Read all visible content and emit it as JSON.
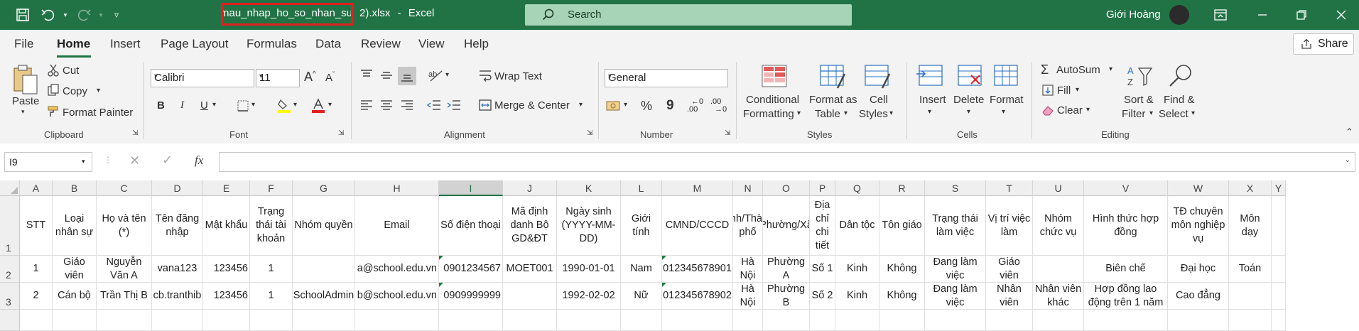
{
  "titlebar": {
    "doc_name": "mau_nhap_ho_so_nhan_su",
    "doc_suffix": "2).xlsx",
    "sep": "-",
    "app": "Excel",
    "search_label": "Search",
    "user_name": "Giới Hoàng",
    "accent": "#217346",
    "highlight": "#e02020"
  },
  "menu": {
    "tabs": [
      "File",
      "Home",
      "Insert",
      "Page Layout",
      "Formulas",
      "Data",
      "Review",
      "View",
      "Help"
    ],
    "active": "Home",
    "share": "Share"
  },
  "ribbon": {
    "paste": "Paste",
    "cut": "Cut",
    "copy": "Copy",
    "format_painter": "Format Painter",
    "clipboard": "Clipboard",
    "font_name": "Calibri",
    "font_size": "11",
    "bold": "B",
    "italic": "I",
    "underline": "U",
    "font": "Font",
    "wrap_text": "Wrap Text",
    "merge_center": "Merge & Center",
    "alignment": "Alignment",
    "number_format": "General",
    "percent": "%",
    "comma": "9",
    "inc_dec": ".00",
    "dec_dec": ".00",
    "number": "Number",
    "conditional_1": "Conditional",
    "conditional_2": "Formatting",
    "format_as_1": "Format as",
    "format_as_2": "Table",
    "cell_styles_1": "Cell",
    "cell_styles_2": "Styles",
    "styles": "Styles",
    "insert": "Insert",
    "delete": "Delete",
    "format": "Format",
    "cells": "Cells",
    "autosum": "AutoSum",
    "fill": "Fill",
    "clear": "Clear",
    "sort_1": "Sort &",
    "sort_2": "Filter",
    "find_1": "Find &",
    "find_2": "Select",
    "editing": "Editing"
  },
  "formula_bar": {
    "name_box": "I9",
    "fx": "fx",
    "value": ""
  },
  "sheet": {
    "columns": [
      "A",
      "B",
      "C",
      "D",
      "E",
      "F",
      "G",
      "H",
      "I",
      "J",
      "K",
      "L",
      "M",
      "N",
      "O",
      "P",
      "Q",
      "R",
      "S",
      "T",
      "U",
      "V",
      "W",
      "X",
      "Y"
    ],
    "selected_column": "I",
    "rows": [
      "1",
      "2",
      "3"
    ],
    "header_row": [
      "STT",
      "Loại nhân sự",
      "Họ và tên (*)",
      "Tên đăng nhập",
      "Mật khẩu",
      "Trạng thái tài khoản",
      "Nhóm quyền",
      "Email",
      "Số điện thoại",
      "Mã định danh Bộ GD&ĐT",
      "Ngày sinh (YYYY-MM-DD)",
      "Giới tính",
      "CMND/CCCD",
      "Tỉnh/Thành phố",
      "Phường/Xã",
      "Địa chỉ chi tiết",
      "Dân tộc",
      "Tôn giáo",
      "Trạng thái làm việc",
      "Vị trí việc làm",
      "Nhóm chức vụ",
      "Hình thức hợp đồng",
      "TĐ chuyên môn nghiệp vụ",
      "Môn dạy"
    ],
    "data_rows": [
      [
        "1",
        "Giáo viên",
        "Nguyễn Văn A",
        "vana123",
        "123456",
        "1",
        "",
        "a@school.edu.vn",
        "0901234567",
        "MOET001",
        "1990-01-01",
        "Nam",
        "012345678901",
        "Hà Nội",
        "Phường A",
        "Số 1",
        "Kinh",
        "Không",
        "Đang làm việc",
        "Giáo viên",
        "",
        "Biên chế",
        "Đại học",
        "Toán"
      ],
      [
        "2",
        "Cán bộ",
        "Trần Thị B",
        "cb.tranthib",
        "123456",
        "1",
        "SchoolAdmin",
        "b@school.edu.vn",
        "0909999999",
        "",
        "1992-02-02",
        "Nữ",
        "012345678902",
        "Hà Nội",
        "Phường B",
        "Số 2",
        "Kinh",
        "Không",
        "Đang làm việc",
        "Nhân viên",
        "Nhân viên khác",
        "Hợp đồng lao động trên 1 năm",
        "Cao đẳng",
        ""
      ]
    ]
  }
}
